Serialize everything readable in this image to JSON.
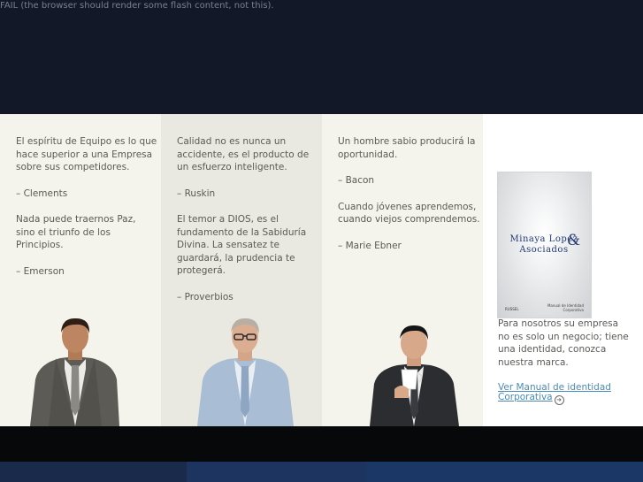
{
  "flash": {
    "fail_text": "FAIL (the browser should render some flash content, not this)."
  },
  "column1": {
    "quotes": [
      "El espíritu de Equipo es lo que hace superior a una Empresa sobre sus competidores.",
      "– Clements",
      "Nada puede traernos Paz, sino el triunfo de los Principios.",
      "– Emerson"
    ]
  },
  "column2": {
    "quotes": [
      "Calidad no es nunca un accidente, es el producto de un esfuerzo inteligente.",
      "– Ruskin",
      "El temor a DIOS, es el fundamento de la Sabiduría Divina. La sensatez te guardará, la prudencia te protegerá.",
      "– Proverbios"
    ]
  },
  "column3": {
    "quotes": [
      "Un hombre sabio producirá la oportunidad.",
      "– Bacon",
      "Cuando jóvenes aprendemos, cuando viejos comprendemos.",
      "– Marie Ebner"
    ]
  },
  "sidebar": {
    "book_cover": {
      "title_line1": "Minaya Lopez",
      "ampersand": "&",
      "title_line2": "Asociados",
      "subtitle": "Manual de Identidad Corporativa",
      "logo_text": "RUSSEL"
    },
    "promo_text": "Para nosotros su empresa no es solo un negocio; tiene una identidad, conozca nuestra marca.",
    "manual_link": "Ver Manual de identidad Corporativa",
    "arrow_icon": "circle-arrow-right-icon"
  },
  "colors": {
    "header_bg": "#121828",
    "footer_bg": "#070809",
    "column_light": "#f4f4ec",
    "column_mid": "#e9e9e1",
    "link": "#4a8ab8",
    "brand_blue": "#223a75"
  }
}
